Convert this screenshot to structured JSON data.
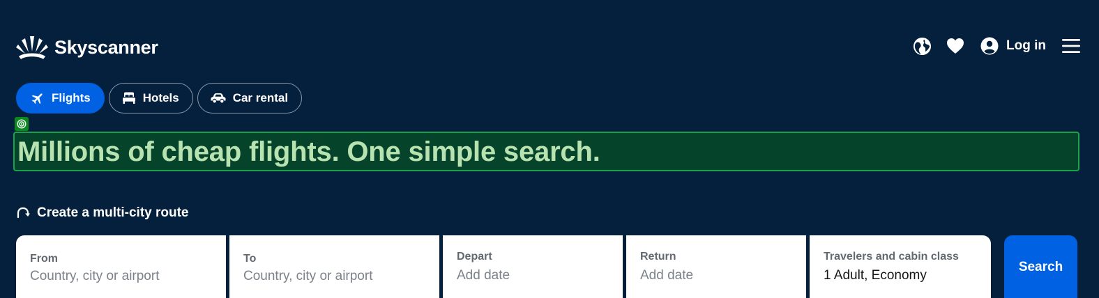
{
  "brand": {
    "name": "Skyscanner"
  },
  "header": {
    "login_label": "Log in",
    "icons": [
      "globe-icon",
      "heart-icon",
      "account-icon",
      "menu-icon"
    ]
  },
  "tabs": [
    {
      "label": "Flights",
      "icon": "plane-icon",
      "active": true
    },
    {
      "label": "Hotels",
      "icon": "bed-icon",
      "active": false
    },
    {
      "label": "Car rental",
      "icon": "car-icon",
      "active": false
    }
  ],
  "hero": {
    "title": "Millions of cheap flights. One simple search."
  },
  "multicity": {
    "label": "Create a multi-city route"
  },
  "search_form": {
    "from": {
      "label": "From",
      "placeholder": "Country, city or airport"
    },
    "to": {
      "label": "To",
      "placeholder": "Country, city or airport"
    },
    "depart": {
      "label": "Depart",
      "placeholder": "Add date"
    },
    "return": {
      "label": "Return",
      "placeholder": "Add date"
    },
    "travelers": {
      "label": "Travelers and cabin class",
      "value": "1 Adult, Economy"
    },
    "search_label": "Search"
  },
  "colors": {
    "background": "#05203c",
    "accent": "#0062e3",
    "highlight_bg": "#05432b",
    "highlight_border": "#16a34a",
    "highlight_text": "#b8e2b0"
  }
}
